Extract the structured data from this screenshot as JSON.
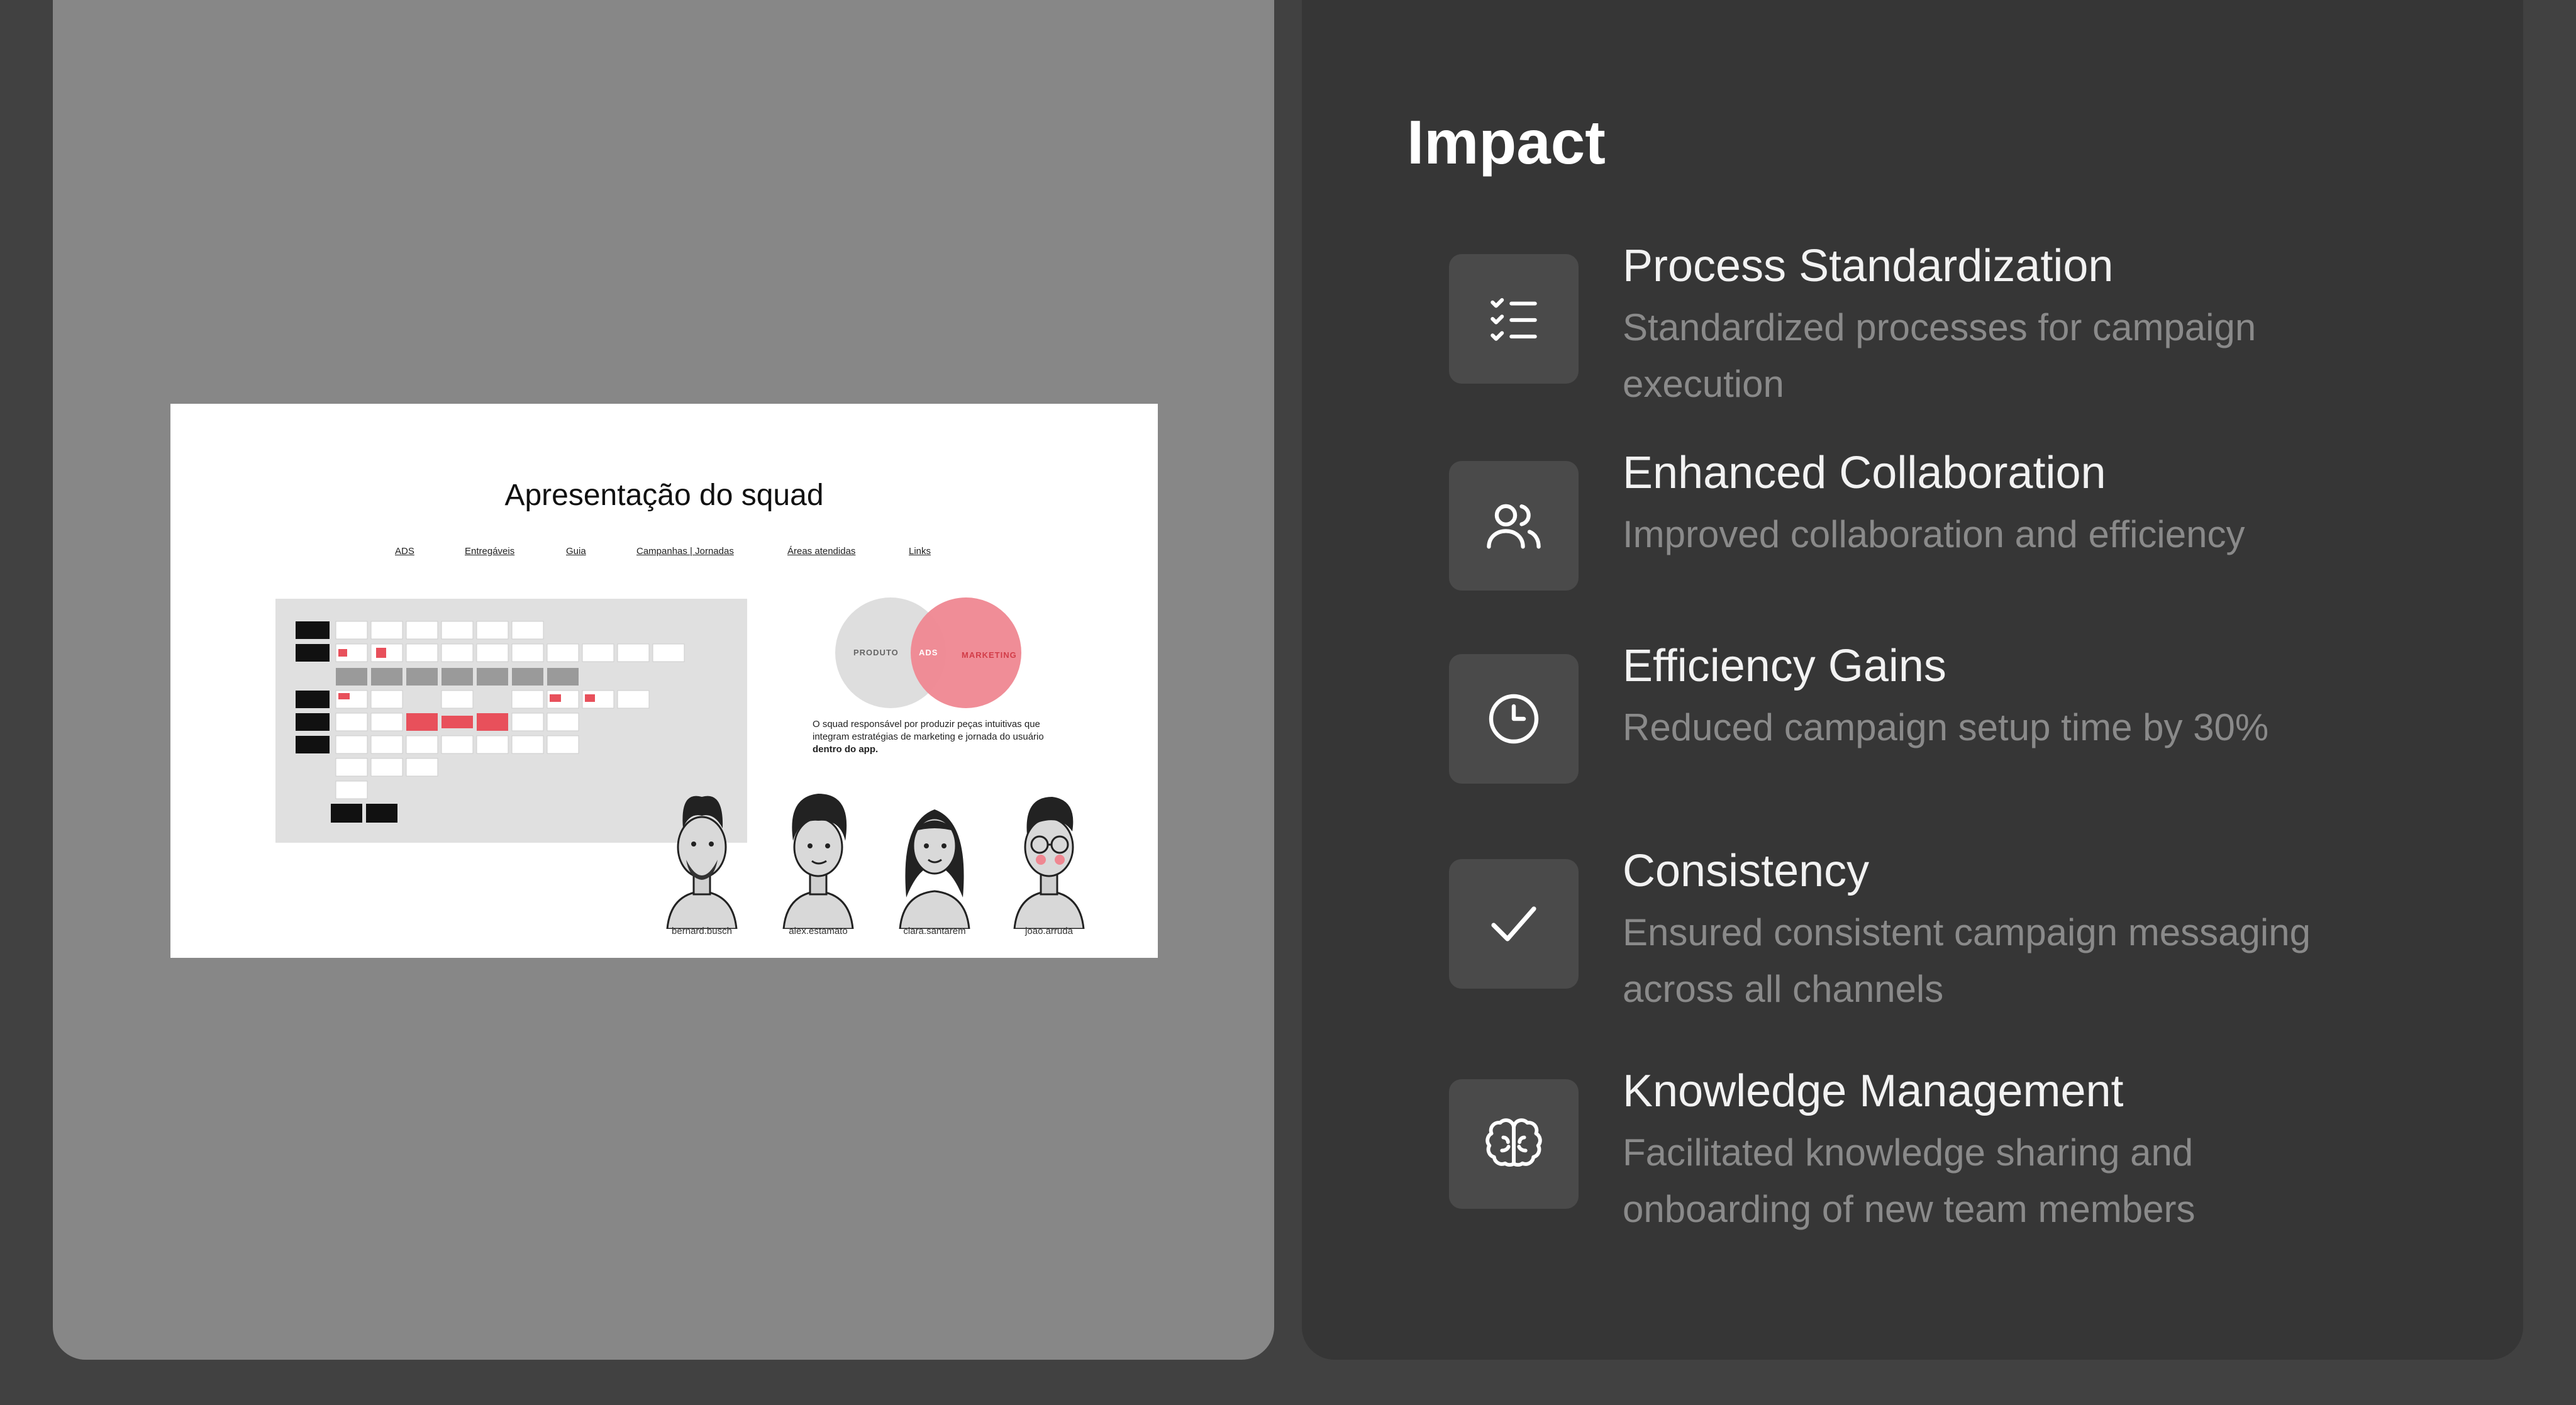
{
  "preview": {
    "slide_title": "Apresentação do squad",
    "nav_links": [
      "ADS",
      "Entregáveis",
      "Guia",
      "Campanhas | Jornadas",
      "Áreas atendidas",
      "Links"
    ],
    "venn": {
      "left_label": "PRODUTO",
      "center_label": "ADS",
      "right_label": "MARKETING"
    },
    "description_main": "O squad responsável por produzir peças intuitivas que integram estratégias de marketing e jornada do usuário ",
    "description_bold": "dentro do app.",
    "members": [
      "bernard.busch",
      "alex.estamato",
      "clara.santarem",
      "joao.arruda"
    ]
  },
  "impact": {
    "title": "Impact",
    "items": [
      {
        "icon": "checklist-icon",
        "heading": "Process Standardization",
        "description": "Standardized processes for campaign execution"
      },
      {
        "icon": "users-icon",
        "heading": "Enhanced Collaboration",
        "description": "Improved collaboration and efficiency"
      },
      {
        "icon": "clock-icon",
        "heading": "Efficiency Gains",
        "description": "Reduced campaign setup time by 30%"
      },
      {
        "icon": "check-icon",
        "heading": "Consistency",
        "description": "Ensured consistent campaign messaging across all channels"
      },
      {
        "icon": "brain-icon",
        "heading": "Knowledge Management",
        "description": "Facilitated knowledge sharing and onboarding of new team members"
      }
    ]
  },
  "colors": {
    "background": "#414141",
    "left_panel": "#878787",
    "right_panel": "#363636",
    "icon_tile": "#4a4a4a",
    "accent_pink": "#ef8791"
  }
}
